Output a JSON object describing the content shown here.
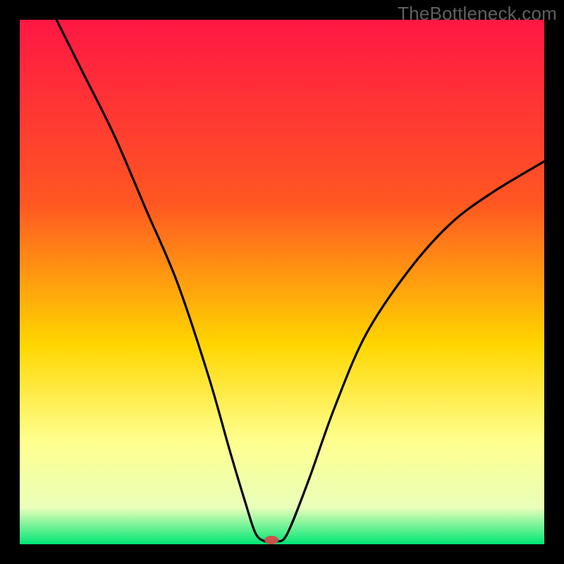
{
  "watermark": "TheBottleneck.com",
  "chart_data": {
    "type": "line",
    "title": "",
    "xlabel": "",
    "ylabel": "",
    "xlim": [
      0,
      100
    ],
    "ylim": [
      0,
      100
    ],
    "grid": false,
    "legend": false,
    "gradient_colors": {
      "top": "#ff1744",
      "mid_upper": "#ff5722",
      "mid": "#ffd600",
      "mid_lower": "#ffff8d",
      "bottom": "#00e676"
    },
    "curve": {
      "name": "bottleneck-curve",
      "stroke": "#000000",
      "points": [
        {
          "x": 7,
          "y": 100
        },
        {
          "x": 12,
          "y": 90
        },
        {
          "x": 18,
          "y": 78
        },
        {
          "x": 24,
          "y": 64
        },
        {
          "x": 30,
          "y": 50
        },
        {
          "x": 36,
          "y": 32
        },
        {
          "x": 40,
          "y": 18
        },
        {
          "x": 43,
          "y": 8
        },
        {
          "x": 45,
          "y": 2
        },
        {
          "x": 47,
          "y": 0.5
        },
        {
          "x": 49,
          "y": 0.5
        },
        {
          "x": 51,
          "y": 2
        },
        {
          "x": 55,
          "y": 12
        },
        {
          "x": 60,
          "y": 26
        },
        {
          "x": 66,
          "y": 40
        },
        {
          "x": 74,
          "y": 52
        },
        {
          "x": 82,
          "y": 61
        },
        {
          "x": 90,
          "y": 67
        },
        {
          "x": 100,
          "y": 73
        }
      ]
    },
    "marker": {
      "x": 48,
      "y": 0.8,
      "color": "#c9524a",
      "rx": 10,
      "ry": 6
    },
    "plot_frame": {
      "stroke": "#000000",
      "stroke_width": 28
    }
  }
}
